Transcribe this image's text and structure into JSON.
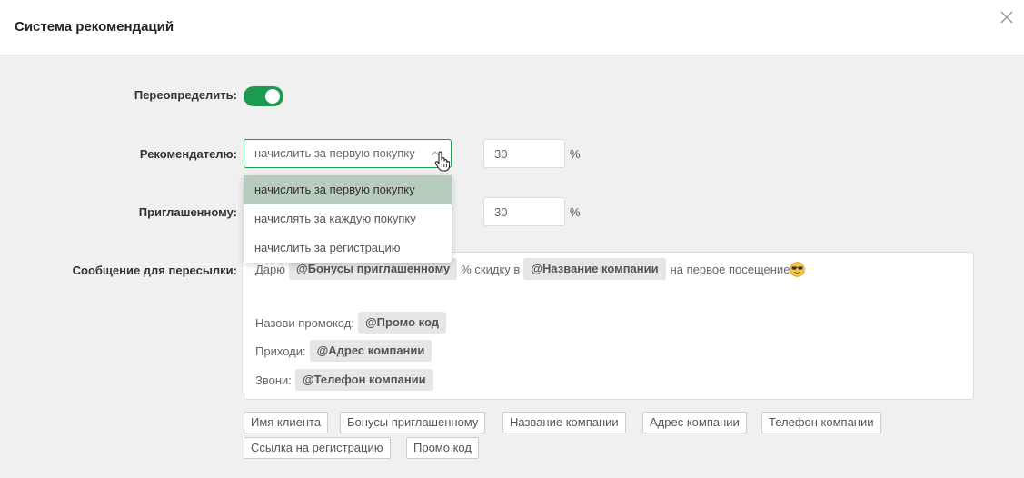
{
  "modal": {
    "title": "Система рекомендаций"
  },
  "fields": {
    "override": {
      "label": "Переопределить:",
      "enabled": true
    },
    "referrer": {
      "label": "Рекомендателю:",
      "selected": "начислить за первую покупку",
      "percent": "30",
      "unit": "%"
    },
    "invited": {
      "label": "Приглашенному:",
      "percent": "30",
      "unit": "%"
    },
    "message": {
      "label": "Сообщение для пересылки:"
    }
  },
  "dropdown": {
    "options": [
      "начислить за первую покупку",
      "начислять за каждую покупку",
      "начислить за регистрацию"
    ]
  },
  "message": {
    "line1": {
      "t1": "Дарю",
      "tag1": "@Бонусы приглашенному",
      "t2": "% скидку в",
      "tag2": "@Название компании",
      "t3": "на первое посещение"
    },
    "line2": {
      "t1": "Назови промокод:",
      "tag1": "@Промо код"
    },
    "line3": {
      "t1": "Приходи:",
      "tag1": "@Адрес компании"
    },
    "line4": {
      "t1": "Звони:",
      "tag1": "@Телефон компании"
    }
  },
  "chips": [
    "Имя клиента",
    "Бонусы приглашенному",
    "Название компании",
    "Адрес компании",
    "Телефон компании",
    "Ссылка на регистрацию",
    "Промо код"
  ],
  "colors": {
    "accent": "#1c9a4f",
    "dropdown_active": "#b7ccbc",
    "background": "#f0f0f0"
  },
  "icons": {
    "close": "close-icon",
    "arrow": "chevron-up-icon",
    "cursor": "hand-pointer-icon",
    "emoji": "sunglasses-emoji-icon"
  }
}
